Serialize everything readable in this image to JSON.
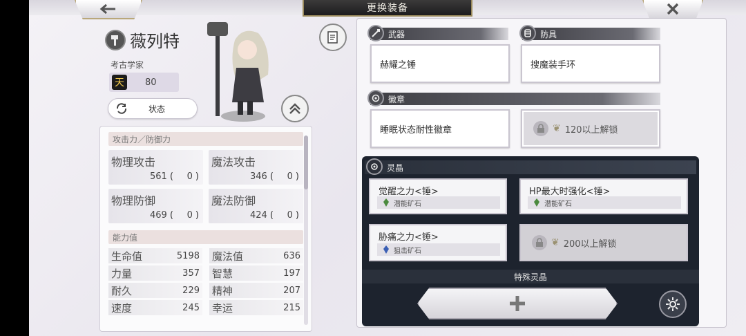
{
  "header": {
    "title": "更换装备",
    "back_icon": "arrow-left-icon",
    "close_icon": "close-icon"
  },
  "character": {
    "name": "薇列特",
    "job": "考古学家",
    "level_badge": "天",
    "level": "80",
    "status_button": "状态"
  },
  "stats": {
    "atk_def_title": "攻击力／防御力",
    "atk_def": [
      {
        "name": "物理攻击",
        "value": "561",
        "bonus": "0"
      },
      {
        "name": "魔法攻击",
        "value": "346",
        "bonus": "0"
      },
      {
        "name": "物理防御",
        "value": "469",
        "bonus": "0"
      },
      {
        "name": "魔法防御",
        "value": "424",
        "bonus": "0"
      }
    ],
    "ability_title": "能力值",
    "abilities": [
      {
        "name": "生命值",
        "value": "5198"
      },
      {
        "name": "魔法值",
        "value": "636"
      },
      {
        "name": "力量",
        "value": "357"
      },
      {
        "name": "智慧",
        "value": "197"
      },
      {
        "name": "耐久",
        "value": "229"
      },
      {
        "name": "精神",
        "value": "207"
      },
      {
        "name": "速度",
        "value": "245"
      },
      {
        "name": "幸运",
        "value": "215"
      }
    ]
  },
  "equipment": {
    "weapon_label": "武器",
    "weapon_item": "赫耀之锤",
    "armor_label": "防具",
    "armor_item": "搜魔装手环",
    "badge_label": "徽章",
    "badge_item": "睡眠状态耐性徽章",
    "badge_locked": "120以上解锁",
    "crystal_label": "灵晶",
    "crystals": [
      {
        "name": "觉醒之力<锤>",
        "ore": "潜能矿石"
      },
      {
        "name": "HP最大时强化<锤>",
        "ore": "潜能矿石"
      },
      {
        "name": "胁痛之力<锤>",
        "ore": "狙击矿石"
      }
    ],
    "crystal_locked": "200以上解锁",
    "special_label": "特殊灵晶"
  },
  "colors": {
    "accent_gold": "#b9a77a",
    "dark_panel": "#1d232e"
  }
}
